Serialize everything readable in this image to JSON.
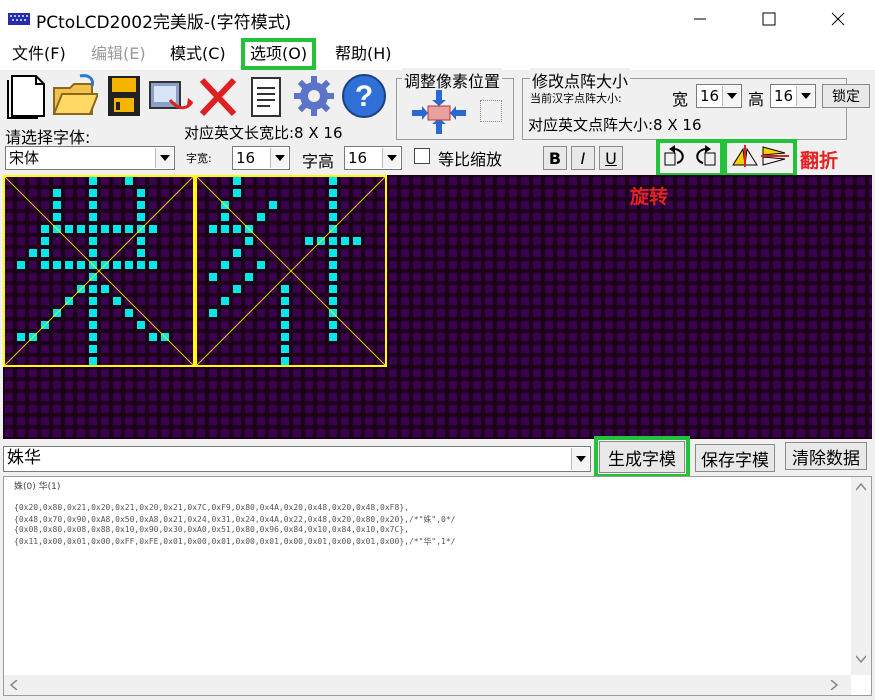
{
  "window": {
    "title": "PCtoLCD2002完美版-(字符模式)",
    "minimize": "─",
    "maximize": "☐",
    "close": "✕"
  },
  "menu": [
    {
      "label": "文件(F)",
      "enabled": true
    },
    {
      "label": "编辑(E)",
      "enabled": false
    },
    {
      "label": "模式(C)",
      "enabled": true
    },
    {
      "label": "选项(O)",
      "enabled": true,
      "highlighted": true
    },
    {
      "label": "帮助(H)",
      "enabled": true
    }
  ],
  "toolbar": {
    "icons": [
      "new-file-icon",
      "open-folder-icon",
      "save-disk-icon",
      "export-icon",
      "delete-x-icon",
      "notepad-icon",
      "gear-icon",
      "help-icon"
    ],
    "adjust_group_label": "调整像素位置",
    "resize_group_label": "修改点阵大小",
    "current_char_size_label": "当前汉字点阵大小:",
    "width_label": "宽",
    "width_value": "16",
    "height_label": "高",
    "height_value": "16",
    "lock_label": "锁定",
    "english_size_label": "对应英文点阵大小:8 X 16"
  },
  "font_row": {
    "select_font_label": "请选择字体:",
    "english_ratio_label": "对应英文长宽比:8 X 16",
    "font_value": "宋体",
    "char_width_label": "字宽:",
    "char_width_value": "16",
    "char_height_label": "字高",
    "char_height_value": "16",
    "proportional_label": "等比缩放",
    "bold_label": "B",
    "italic_label": "I",
    "underline_label": "U",
    "rotate_label": "旋转",
    "flip_label": "翻折"
  },
  "colors": {
    "pixel_on": "#00e8e8",
    "pixel_off": "#3a0050",
    "canvas_bg": "#1c0018",
    "grid_box": "#ffff00",
    "highlight": "#22c23a",
    "annotation_red": "#e32222"
  },
  "glyph_rows": [
    [
      "0000000100100000",
      "0000100100010000",
      "0000100100010000",
      "0000100100010000",
      "0001111111111000",
      "0001000100010000",
      "0011000100010000",
      "0101111111111000",
      "0000000100000000",
      "0000001110000000",
      "0000010101000000",
      "0000100100100000",
      "0001000100010000",
      "0110000100001100",
      "0000000100000000",
      "0000000100000000"
    ],
    [
      "0001000000010000",
      "0001000000010000",
      "0010001000010000",
      "0010010000010000",
      "0111100000010000",
      "0000100001111100",
      "0001000000010000",
      "0010010000010000",
      "0100100000010000",
      "0001000100010000",
      "0010000100010000",
      "0100000100010000",
      "0000000100010000",
      "0000000100010000",
      "0000000100000000",
      "0000000100000000"
    ]
  ],
  "bottom": {
    "input_value": "姝华",
    "generate_label": "生成字模",
    "save_label": "保存字模",
    "clear_label": "清除数据"
  },
  "output": {
    "header": "姝(0) 华(1)",
    "lines": [
      "{0x20,0x80,0x21,0x20,0x21,0x20,0x21,0x7C,0xF9,0x80,0x4A,0x20,0x48,0x20,0x48,0xF8},",
      "{0x48,0x70,0x90,0xA8,0x50,0xA8,0x21,0x24,0x31,0x24,0x4A,0x22,0x48,0x20,0x80,0x20},/*\"姝\",0*/",
      "{0x08,0x80,0x08,0x88,0x10,0x90,0x30,0xA0,0x51,0x80,0x96,0x84,0x10,0x84,0x10,0x7C},",
      "{0x11,0x00,0x01,0x00,0xFF,0xFE,0x01,0x00,0x01,0x00,0x01,0x00,0x01,0x00,0x01,0x00},/*\"华\",1*/"
    ]
  }
}
